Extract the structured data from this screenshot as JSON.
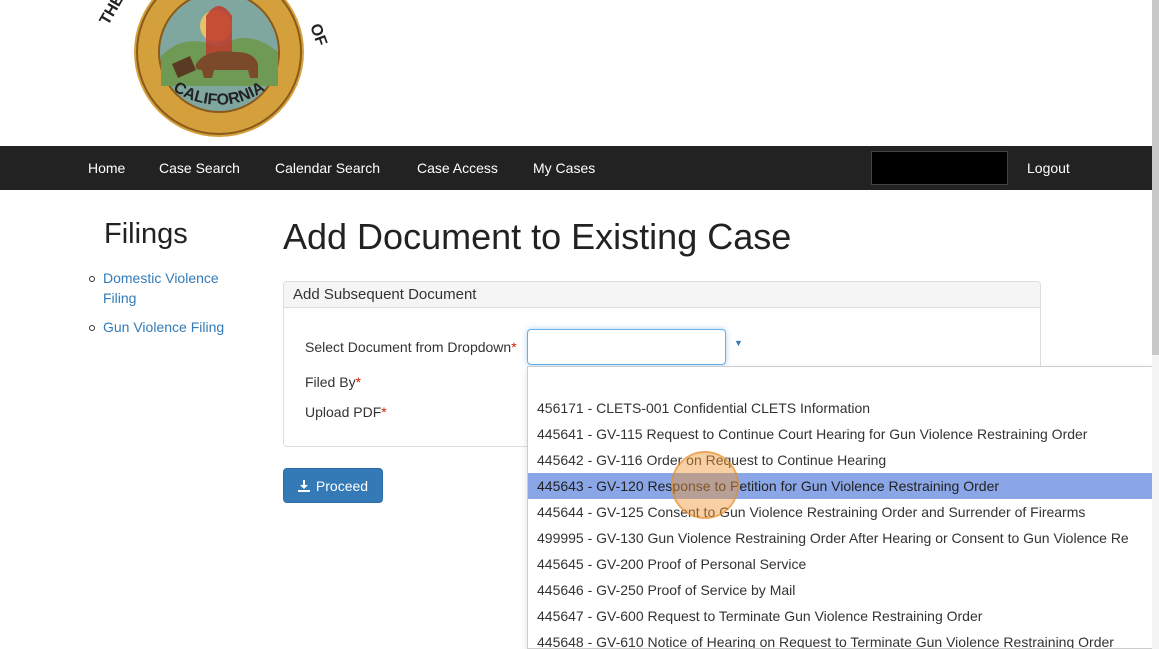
{
  "seal": {
    "text": "THE GREAT SEAL OF THE STATE OF CALIFORNIA",
    "visible_text": "CALIFORNIA"
  },
  "nav": {
    "items": [
      "Home",
      "Case Search",
      "Calendar Search",
      "Case Access",
      "My Cases"
    ],
    "logout": "Logout"
  },
  "sidebar": {
    "title": "Filings",
    "links": [
      "Domestic Violence Filing",
      "Gun Violence Filing"
    ]
  },
  "main": {
    "title": "Add Document to Existing Case",
    "panel_heading": "Add Subsequent Document",
    "labels": {
      "select_document": "Select Document from Dropdown",
      "filed_by": "Filed By",
      "upload_pdf": "Upload PDF",
      "required_marker": "*"
    },
    "select_value": "",
    "proceed_label": "Proceed"
  },
  "dropdown": {
    "highlighted_index": 3,
    "options": [
      "456171 - CLETS-001 Confidential CLETS Information",
      "445641 - GV-115 Request to Continue Court Hearing for Gun Violence Restraining Order",
      "445642 - GV-116 Order on Request to Continue Hearing",
      "445643 - GV-120 Response to Petition for Gun Violence Restraining Order",
      "445644 - GV-125 Consent to Gun Violence Restraining Order and Surrender of Firearms",
      "499995 - GV-130 Gun Violence Restraining Order After Hearing or Consent to Gun Violence Re",
      "445645 - GV-200 Proof of Personal Service",
      "445646 - GV-250 Proof of Service by Mail",
      "445647 - GV-600 Request to Terminate Gun Violence Restraining Order",
      "445648 - GV-610 Notice of Hearing on Request to Terminate Gun Violence Restraining Order"
    ]
  },
  "colors": {
    "navbar_bg": "#222222",
    "link": "#337ab7",
    "button_bg": "#337ab7",
    "highlight": "#8aa6e6",
    "required": "#cc2200",
    "seal_gold": "#d4a03c"
  }
}
